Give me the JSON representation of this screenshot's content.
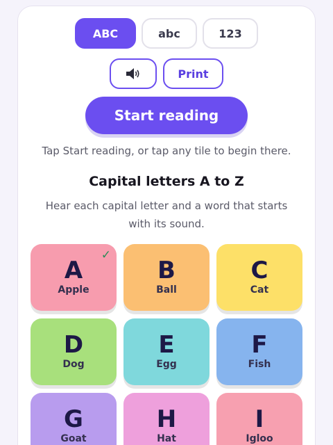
{
  "modes": [
    {
      "label": "ABC",
      "active": true
    },
    {
      "label": "abc",
      "active": false
    },
    {
      "label": "123",
      "active": false
    }
  ],
  "tools": {
    "speaker_icon": "speaker-icon",
    "print_label": "Print"
  },
  "start_label": "Start reading",
  "hint": "Tap Start reading, or tap any tile to begin there.",
  "section": {
    "title": "Capital letters A to Z",
    "description": "Hear each capital letter and a word that starts with its sound."
  },
  "tiles": [
    {
      "letter": "A",
      "word": "Apple",
      "color": "#f79cae",
      "checked": true
    },
    {
      "letter": "B",
      "word": "Ball",
      "color": "#fbbf72"
    },
    {
      "letter": "C",
      "word": "Cat",
      "color": "#fde068"
    },
    {
      "letter": "D",
      "word": "Dog",
      "color": "#a8e07c"
    },
    {
      "letter": "E",
      "word": "Egg",
      "color": "#7fd8dc"
    },
    {
      "letter": "F",
      "word": "Fish",
      "color": "#86b4ee"
    },
    {
      "letter": "G",
      "word": "Goat",
      "color": "#b89cee"
    },
    {
      "letter": "H",
      "word": "Hat",
      "color": "#eea0dc"
    },
    {
      "letter": "I",
      "word": "Igloo",
      "color": "#f7a0b0"
    }
  ],
  "check_symbol": "✓",
  "colors": {
    "accent": "#6b4ef0"
  }
}
